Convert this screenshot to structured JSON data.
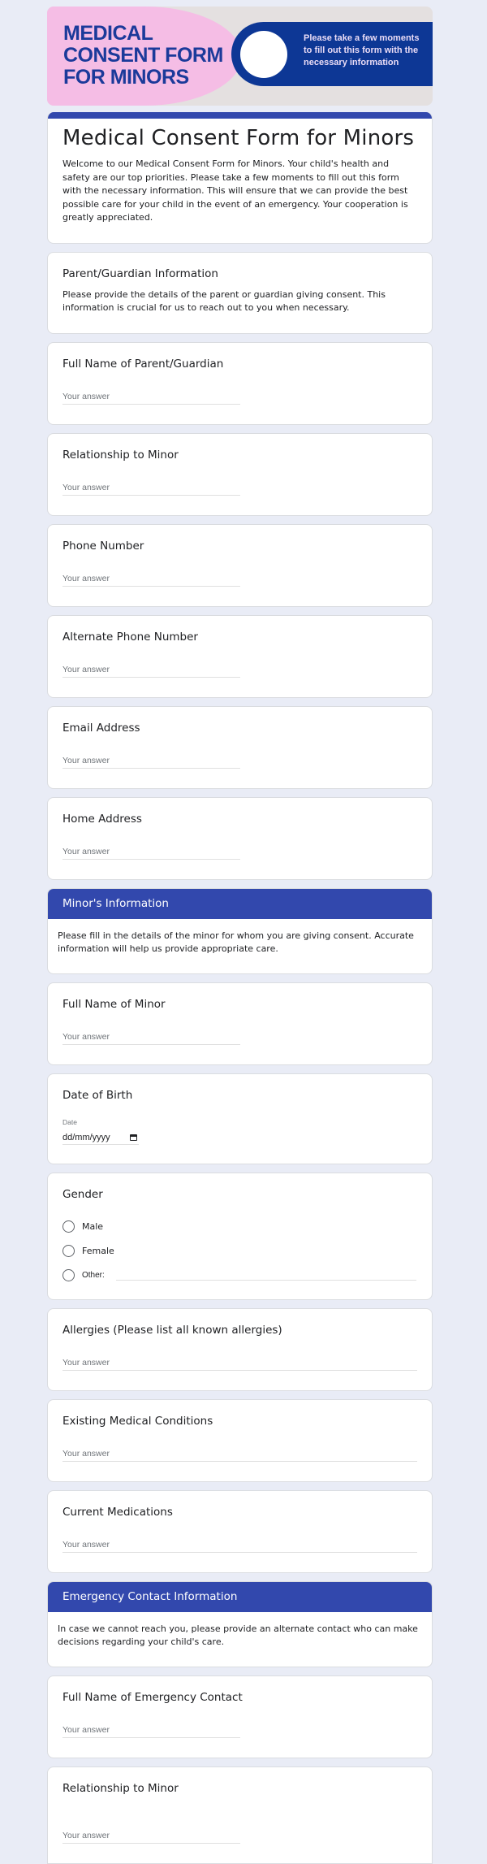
{
  "banner": {
    "title_lines": [
      "MEDICAL",
      "CONSENT FORM",
      "FOR MINORS"
    ],
    "tagline": "Please take a few moments to fill out this form with the necessary information",
    "colors": {
      "pink": "#f5bde5",
      "navy": "#0d3795",
      "grey": "#e4e0e0"
    }
  },
  "form": {
    "title": "Medical Consent Form for Minors",
    "description": "Welcome to our Medical Consent Form for Minors. Your child's health and safety are our top priorities. Please take a few moments to fill out this form with the necessary information. This will ensure that we can provide the best possible care for your child in the event of an emergency. Your cooperation is greatly appreciated.",
    "accent_color": "#3248ad"
  },
  "parent_section": {
    "title": "Parent/Guardian Information",
    "description": "Please provide the details of the parent or guardian giving consent. This information is crucial for us to reach out to you when necessary.",
    "questions": [
      {
        "title": "Full Name of Parent/Guardian",
        "placeholder": "Your answer"
      },
      {
        "title": "Relationship to Minor",
        "placeholder": "Your answer"
      },
      {
        "title": "Phone Number",
        "placeholder": "Your answer"
      },
      {
        "title": "Alternate Phone Number",
        "placeholder": "Your answer"
      },
      {
        "title": "Email Address",
        "placeholder": "Your answer"
      },
      {
        "title": "Home Address",
        "placeholder": "Your answer"
      }
    ]
  },
  "minor_section": {
    "title": "Minor's Information",
    "description": "Please fill in the details of the minor for whom you are giving consent. Accurate information will help us provide appropriate care.",
    "full_name": {
      "title": "Full Name of Minor",
      "placeholder": "Your answer"
    },
    "dob": {
      "title": "Date of Birth",
      "label": "Date",
      "placeholder": "dd/mm/yyyy"
    },
    "gender": {
      "title": "Gender",
      "options": [
        "Male",
        "Female",
        "Other:"
      ]
    },
    "allergies": {
      "title": "Allergies (Please list all known allergies)",
      "placeholder": "Your answer"
    },
    "conditions": {
      "title": "Existing Medical Conditions",
      "placeholder": "Your answer"
    },
    "medications": {
      "title": "Current Medications",
      "placeholder": "Your answer"
    }
  },
  "emergency_section": {
    "title": "Emergency Contact Information",
    "description": "In case we cannot reach you, please provide an alternate contact who can make decisions regarding your child's care.",
    "questions": [
      {
        "title": "Full Name of Emergency Contact",
        "placeholder": "Your answer"
      },
      {
        "title": "Relationship to Minor",
        "placeholder": "Your answer"
      }
    ]
  }
}
